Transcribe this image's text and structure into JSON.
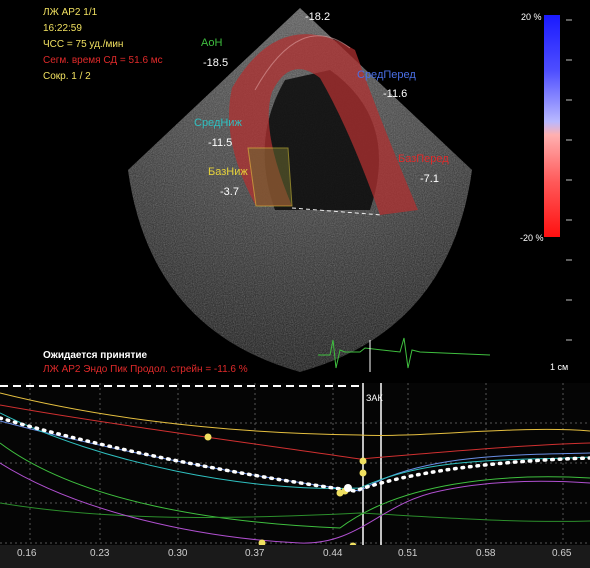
{
  "header": {
    "title": "ЛЖ AP2 1/1",
    "time": "16:22:59",
    "hr": "ЧСС = 75 уд./мин",
    "seg_time": "Сегм. время СД = 51.6 мс",
    "contraction": "Сокр. 1 / 2"
  },
  "segments": [
    {
      "name": "АоН",
      "value": "-18.5",
      "color": "#3fbf3f"
    },
    {
      "name": "",
      "value": "-18.2",
      "color": "#ffffff"
    },
    {
      "name": "СредПеред",
      "value": "-11.6",
      "color": "#4a6fe6"
    },
    {
      "name": "СредНиж",
      "value": "-11.5",
      "color": "#2fc0c0"
    },
    {
      "name": "БазНиж",
      "value": "-3.7",
      "color": "#e6d23a"
    },
    {
      "name": "БазПеред",
      "value": "-7.1",
      "color": "#e02a2a"
    }
  ],
  "colorbar": {
    "top_label": "20 %",
    "bottom_label": "-20 %"
  },
  "scale_label": "1 см",
  "status": {
    "awaiting": "Ожидается принятие",
    "metric": "ЛЖ AP2 Эндо Пик Продол. стрейн = -11.6 %"
  },
  "avc_marker": "ЗАК",
  "graph": {
    "x_ticks": [
      "0.16",
      "0.23",
      "0.30",
      "0.37",
      "0.44",
      "0.51",
      "0.58",
      "0.65"
    ]
  },
  "colors": {
    "accent_red": "#e02a2a",
    "header_yellow": "#f0e060",
    "graph_grid": "#555555"
  }
}
